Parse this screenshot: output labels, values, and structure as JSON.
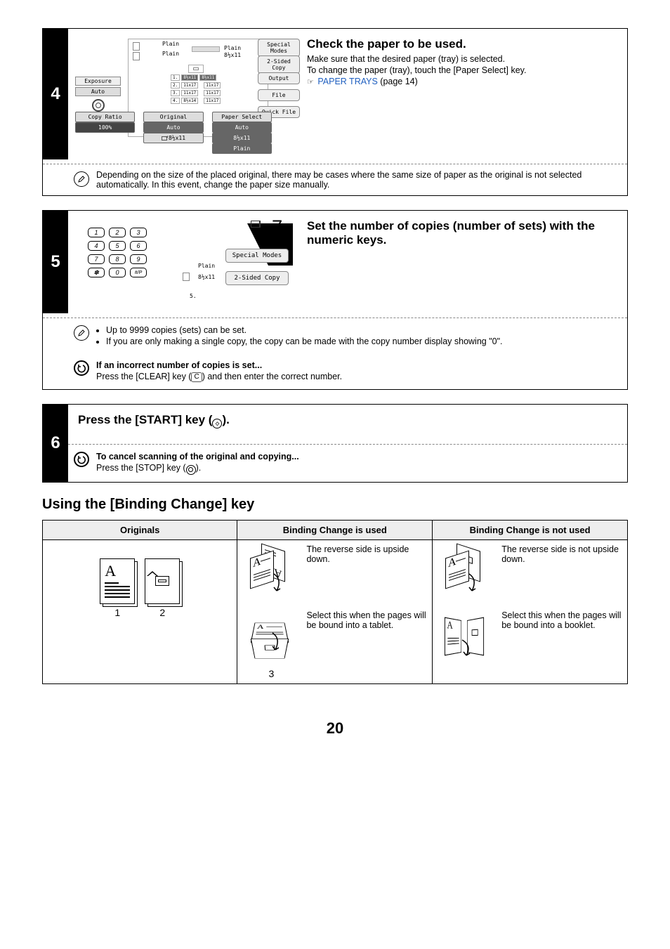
{
  "step4": {
    "number": "4",
    "heading": "Check the paper to be used.",
    "body_line1": "Make sure that the desired paper (tray) is selected.",
    "body_line2": "To change the paper (tray), touch the [Paper Select] key.",
    "link_text": "PAPER TRAYS",
    "link_page": " (page 14)",
    "pointer": "☞",
    "note": "Depending on the size of the placed original, there may be cases where the same size of paper as the original is not selected automatically. In this event, change the paper size manually.",
    "panel": {
      "top_label1": "Plain",
      "top_label2": "Plain",
      "small_plain": "Plain",
      "small_size": "8½x11",
      "exposure": "Exposure",
      "auto": "Auto",
      "copy_ratio_lbl": "Copy Ratio",
      "copy_ratio_val": "100%",
      "original_lbl": "Original",
      "original_auto": "Auto",
      "original_size": "8½x11",
      "paper_select_lbl": "Paper Select",
      "ps_auto": "Auto",
      "ps_size": "8½x11",
      "ps_plain": "Plain",
      "special_modes": "Special Modes",
      "two_sided": "2-Sided Copy",
      "output": "Output",
      "file": "File",
      "quick_file": "Quick File",
      "trays": {
        "r1a": "1.",
        "r1b": "8½x11",
        "r1c": "8½x11",
        "r2a": "2.",
        "r2b": "11x17",
        "r3a": "3.",
        "r3b": "11x17",
        "r4a": "4.",
        "r4b": "8½x14",
        "r2c": "11x17",
        "r3c": "11x17",
        "r4c": "11x17"
      }
    }
  },
  "step5": {
    "number": "5",
    "heading": "Set the number of copies (number of sets) with the numeric keys.",
    "keys": [
      "1",
      "2",
      "3",
      "4",
      "5",
      "6",
      "7",
      "8",
      "9",
      "✽",
      "0",
      "#/P"
    ],
    "display_big": "7",
    "lcd_plain": "Plain",
    "lcd_size": "8½x11",
    "lcd_n5": "5.",
    "special_modes": "Special Modes",
    "two_sided": "2-Sided Copy",
    "note_li1": "Up to 9999 copies (sets) can be set.",
    "note_li2": "If you are only making a single copy, the copy can be made with the copy number display showing \"0\".",
    "tip_head": "If an incorrect number of copies is set...",
    "tip_body_a": "Press the [CLEAR] key (",
    "tip_clear": "C",
    "tip_body_b": ") and then enter the correct number."
  },
  "step6": {
    "number": "6",
    "heading_a": "Press the [START] key (",
    "heading_b": ").",
    "tip_head": "To cancel scanning of the original and copying...",
    "tip_body_a": "Press the [STOP] key (",
    "tip_body_b": ")."
  },
  "binding": {
    "section_title": "Using the [Binding Change] key",
    "th_orig": "Originals",
    "th_used": "Binding Change is used",
    "th_notused": "Binding Change is not used",
    "orig_num1": "1",
    "orig_num2": "2",
    "used_row1_text": "The reverse side is upside down.",
    "used_row2_text": "Select this when the pages will be bound into a tablet.",
    "used_row2_num": "3",
    "notused_row1_text": "The reverse side is not upside down.",
    "notused_row2_text": "Select this when the pages will be bound into a booklet.",
    "glyph_A": "A"
  },
  "page_number": "20"
}
